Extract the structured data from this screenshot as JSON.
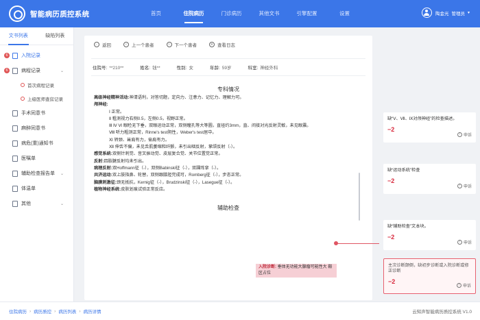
{
  "app": {
    "title": "智能病历质控系统"
  },
  "nav": {
    "items": [
      {
        "label": "首页"
      },
      {
        "label": "住院病历"
      },
      {
        "label": "门诊病历"
      },
      {
        "label": "其他文书"
      },
      {
        "label": "引擎配置"
      },
      {
        "label": "设置"
      }
    ],
    "active_index": 1
  },
  "user": {
    "name": "陶金光",
    "role": "管理员"
  },
  "sidebar": {
    "tabs": [
      {
        "label": "文书列表"
      },
      {
        "label": "缺陷列表"
      }
    ],
    "items": [
      {
        "label": "入院记录",
        "badge": "6"
      },
      {
        "label": "病程记录",
        "badge": "6"
      },
      {
        "label": "首次病程记录"
      },
      {
        "label": "上级医师查房记录"
      },
      {
        "label": "手术同意书"
      },
      {
        "label": "麻醉同意书"
      },
      {
        "label": "病危(重)通知书"
      },
      {
        "label": "医嘱单"
      },
      {
        "label": "辅助检查报告单"
      },
      {
        "label": "体温单"
      },
      {
        "label": "其他"
      }
    ]
  },
  "toolbar": {
    "back": "返回",
    "prev": "上一个患者",
    "next": "下一个患者",
    "log": "查看日志"
  },
  "patient": {
    "id_label": "住院号:",
    "id_value": "**210**",
    "name_label": "姓名:",
    "name_value": "钱**",
    "sex_label": "性别:",
    "sex_value": "女",
    "age_label": "年龄:",
    "age_value": "59岁",
    "dept_label": "科室:",
    "dept_value": "神经外科"
  },
  "document": {
    "section1": "专科情况",
    "lines": [
      {
        "head": "高级神经精神活动:",
        "text": "神清语利，对答切题，定向力、注意力、记忆力、理解力可。"
      },
      {
        "head": "颅神经:",
        "text": ""
      },
      {
        "indent": "Ⅰ 正常。"
      },
      {
        "indent": "Ⅱ 粗测视力右侧0.5，左侧0.5，视野正常。"
      },
      {
        "indent": "Ⅲ Ⅳ Ⅵ 眼睑无下垂，双眼运动正常，双侧瞳孔等大等圆，直径约3mm，直、间接对光反射灵敏，未见眼震。"
      },
      {
        "indent": "Ⅷ 听力粗测正常，Rinne's test阴性，Weber's test居中。"
      },
      {
        "indent": "Ⅺ 转颈、耸肩有力，偷肩有力。"
      },
      {
        "indent": "Ⅻ 伸舌不偏，未见舌肌萎缩和纤颤，未引出咽反射，掌颌反射（-）。"
      },
      {
        "head": "感觉系统:",
        "text": "双侧针刺觉、音叉振动觉、皮层复合觉、关节位置觉正常。"
      },
      {
        "head": "反射:",
        "text": "四肢腱反射均未引出。"
      },
      {
        "head": "病理反射:",
        "text": "双Hoffmann征（-），双侧Babinski征（-），双踝阵挛（-）。"
      },
      {
        "head": "共济运动:",
        "text": "双上肢指鼻、轮替，双侧跟膝胫完成可，Romberg征（-），步态正常。"
      },
      {
        "head": "脑膜刺激征:",
        "text": "颈无抵抗，Kernig征（-），Brudzinski征（-），Lasegue征（-）。"
      },
      {
        "head": "植物神经系统:",
        "text": "皮肤划痕试验正常反应。"
      }
    ],
    "section2": "辅助检查",
    "highlight_head": "入院诊断:",
    "highlight_text": "垂体无功能大腺瘤可能性大 鞍区占位"
  },
  "defects": [
    {
      "text": "缺“Ⅴ、Ⅶ、Ⅸ对颅神经”的检查描述。",
      "score": "−2",
      "appeal": "申诉"
    },
    {
      "text": "缺“运动系统”检查",
      "score": "−2",
      "appeal": "申诉"
    },
    {
      "text": "缺“辅助检查”文本块。",
      "score": "−2",
      "appeal": "申诉"
    },
    {
      "text": "主次诊断颠倒，缺初步诊断或入院诊断或修正诊断",
      "score": "−2",
      "appeal": "申诉"
    }
  ],
  "footer": {
    "crumbs": [
      "住院病历",
      "病历质控",
      "病历列表",
      "病历详情"
    ],
    "copyright": "云知声智能病历质控系统  V1.0"
  },
  "colors": {
    "brand": "#3b76e8",
    "defect": "#d8283c",
    "highlight": "#f6cfd5"
  }
}
